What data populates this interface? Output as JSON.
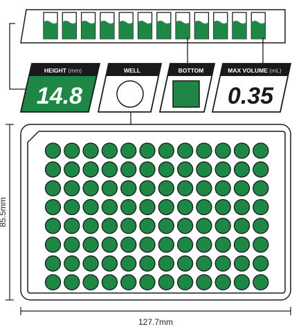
{
  "height": {
    "label": "HEIGHT",
    "unit": "(mm)",
    "value": "14.8"
  },
  "well": {
    "label": "WELL"
  },
  "bottom": {
    "label": "BOTTOM"
  },
  "max_volume": {
    "label": "MAX VOLUME",
    "unit": "(mL)",
    "value": "0.35"
  },
  "dimensions": {
    "width": "127.7mm",
    "depth": "85.5mm"
  },
  "plate": {
    "rows": 8,
    "columns": 12
  },
  "colors": {
    "accent": "#1e8745",
    "outline": "#1a1a1a",
    "background": "#ffffff"
  }
}
